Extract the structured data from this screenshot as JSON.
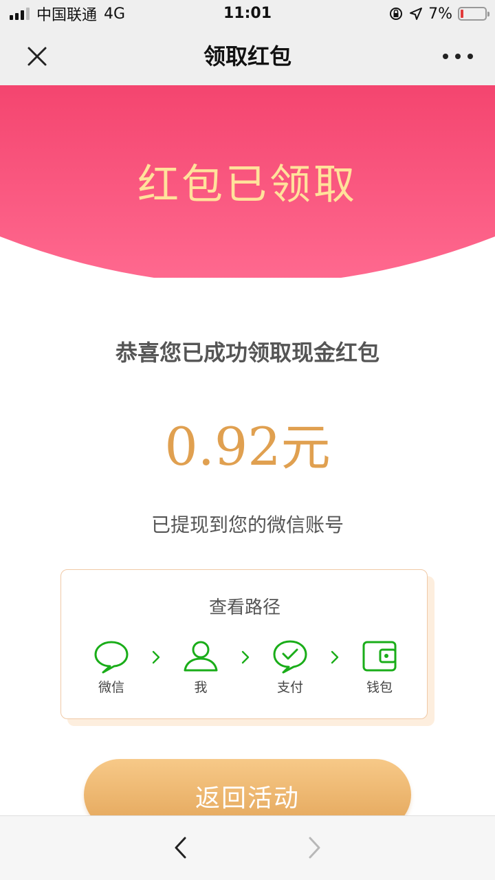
{
  "status_bar": {
    "carrier": "中国联通",
    "network": "4G",
    "time": "11:01",
    "battery": "7%"
  },
  "nav": {
    "title": "领取红包",
    "close_icon": "close-icon",
    "more_icon": "more-dots-icon"
  },
  "hero": {
    "title": "红包已领取",
    "color_top": "#f4456f",
    "color_bottom": "#ff6a90",
    "title_color": "#ffe29b"
  },
  "main": {
    "congrats": "恭喜您已成功领取现金红包",
    "amount_value": "0.92",
    "amount_unit": "元",
    "withdraw_note": "已提现到您的微信账号"
  },
  "path_card": {
    "title": "查看路径",
    "steps": [
      {
        "label": "微信",
        "icon": "chat-bubble-icon"
      },
      {
        "label": "我",
        "icon": "person-icon"
      },
      {
        "label": "支付",
        "icon": "pay-check-icon"
      },
      {
        "label": "钱包",
        "icon": "wallet-icon"
      }
    ],
    "accent": "#1aad19"
  },
  "actions": {
    "return_label": "返回活动"
  },
  "toolbar": {
    "back_icon": "back-chevron-icon",
    "forward_icon": "forward-chevron-icon"
  }
}
